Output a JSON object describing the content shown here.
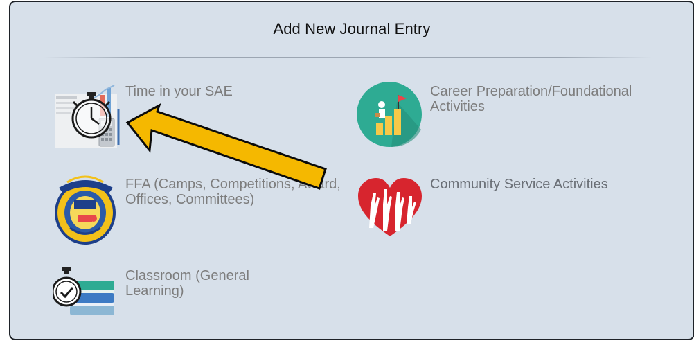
{
  "dialog": {
    "title": "Add New Journal Entry"
  },
  "options": [
    {
      "label": "Time in your SAE",
      "icon": "stopwatch-chart-icon"
    },
    {
      "label": "Career Preparation/Foundational Activities",
      "icon": "career-ladder-icon"
    },
    {
      "label": "FFA (Camps, Competitions, Award, Offices, Committees)",
      "icon": "ffa-emblem-icon"
    },
    {
      "label": "Community Service Activities",
      "icon": "heart-hands-icon"
    },
    {
      "label": "Classroom (General Learning)",
      "icon": "stopwatch-books-icon"
    }
  ],
  "annotation": {
    "arrow_color": "#f5b800",
    "arrow_outline": "#0b0b0b"
  },
  "colors": {
    "dialog_bg": "#d7e0ea",
    "label_text": "#7d7d7d",
    "border": "#1e2228"
  }
}
